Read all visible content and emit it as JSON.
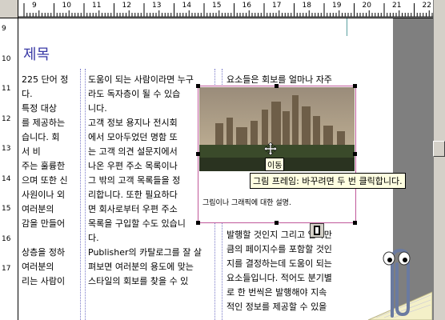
{
  "rulers": {
    "top_numbers": [
      "9",
      "10",
      "11",
      "12",
      "13",
      "14",
      "15",
      "16",
      "17",
      "18",
      "19",
      "20",
      "21",
      "22"
    ],
    "left_numbers": [
      "9",
      "10",
      "11",
      "12",
      "13",
      "14",
      "15",
      "16",
      "17"
    ]
  },
  "document": {
    "title": "제목",
    "col1": [
      "225 단어 정",
      "다.",
      "특정 대상",
      "를 제공하는",
      "습니다. 회",
      "서 비",
      "주는 훌륭한",
      "으며 또한 신",
      "사원이나 외",
      "여러분의",
      "감을 만들어",
      "",
      "상층을 정하",
      "여러분의",
      "리는 사람이"
    ],
    "col2": [
      "도움이 되는 사람이라면 누구",
      "라도 독자층이 될 수 있습",
      "니다.",
      "고객 정보 용지나 전시회",
      "에서 모아두었던 명함 또",
      "는 고객 의견 설문지에서",
      "나온 우편 주소 목록이나",
      "그 밖의 고객 목록들을 정",
      "리합니다. 또한 필요하다",
      "면 회사로부터 우편 주소",
      "목록을 구입할 수도 있습니",
      "다.",
      "Publisher의 카탈로그를 잘 살",
      "펴보면 여러분의 용도에 맞는",
      "스타일의 회보를 찾을 수 있"
    ],
    "col3_top": "요소들은 회보를 얼마나 자주",
    "col3_bottom": [
      "발행할 것인지 그리고 얼마만",
      "큼의 페이지수를 포함할 것인",
      "지를 결정하는데 도움이 되는",
      "요소들입니다. 적어도 분기별",
      "로 한 번씩은 발행해야 지속",
      "적인 정보를 제공할 수 있을"
    ],
    "caption": "그림이나 그래픽에 대한 설명.",
    "tooltip": "그림 프레임: 바꾸려면 두 번 클릭합니다.",
    "tooltip_small": "이동"
  },
  "colors": {
    "title": "#3a3aa6",
    "frame_border": "#c0589a",
    "guide": "#7a7ac8"
  },
  "icons": {
    "assistant": "office-assistant-paperclip-icon",
    "cursor": "move-cursor-icon",
    "helper": "frame-connect-icon"
  }
}
